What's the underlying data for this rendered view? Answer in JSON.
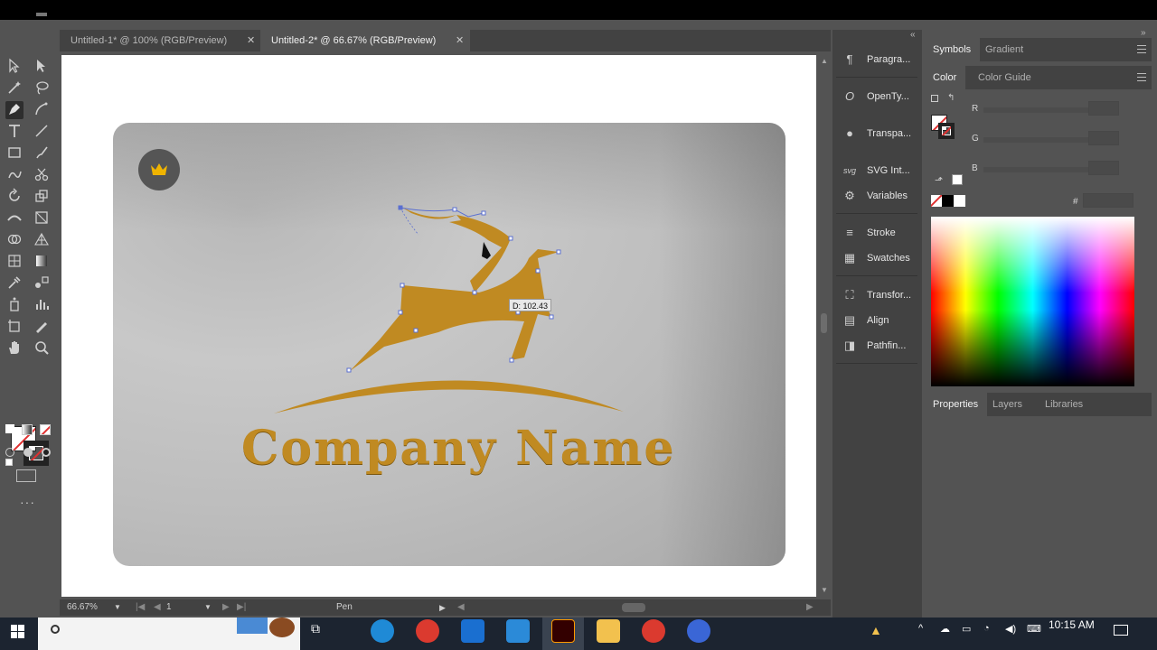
{
  "tabs": [
    {
      "label": "Untitled-1* @ 100% (RGB/Preview)",
      "active": false
    },
    {
      "label": "Untitled-2* @ 66.67% (RGB/Preview)",
      "active": true
    }
  ],
  "tab_close_glyph": "✕",
  "canvas": {
    "company_name": "Company Name",
    "pen_tooltip": "D: 102.43",
    "logo_color": "#c08a22",
    "badge_icon": "crown-icon"
  },
  "status": {
    "zoom": "66.67%",
    "artboard_number": "1",
    "current_tool": "Pen"
  },
  "dock_panels": [
    {
      "label": "Paragra...",
      "icon": "paragraph-icon"
    },
    {
      "label": "OpenTy...",
      "icon": "opentype-icon"
    },
    {
      "label": "Transpa...",
      "icon": "transparency-icon"
    },
    {
      "label": "SVG Int...",
      "icon": "svg-interactivity-icon"
    },
    {
      "label": "Variables",
      "icon": "variables-icon"
    },
    {
      "label": "Stroke",
      "icon": "stroke-icon"
    },
    {
      "label": "Swatches",
      "icon": "swatches-icon"
    },
    {
      "label": "Transfor...",
      "icon": "transform-icon"
    },
    {
      "label": "Align",
      "icon": "align-icon"
    },
    {
      "label": "Pathfin...",
      "icon": "pathfinder-icon"
    }
  ],
  "right_panel": {
    "top_tabs": [
      "Symbols",
      "Gradient"
    ],
    "color_tabs": [
      "Color",
      "Color Guide"
    ],
    "channels": [
      "R",
      "G",
      "B"
    ],
    "hex_label": "#",
    "bottom_tabs": [
      "Properties",
      "Layers",
      "Libraries"
    ]
  },
  "taskbar": {
    "time": "10:15 AM"
  },
  "colors": {
    "app_bg": "#535353",
    "panel_bg": "#424242",
    "accent_gold": "#c08a22"
  }
}
